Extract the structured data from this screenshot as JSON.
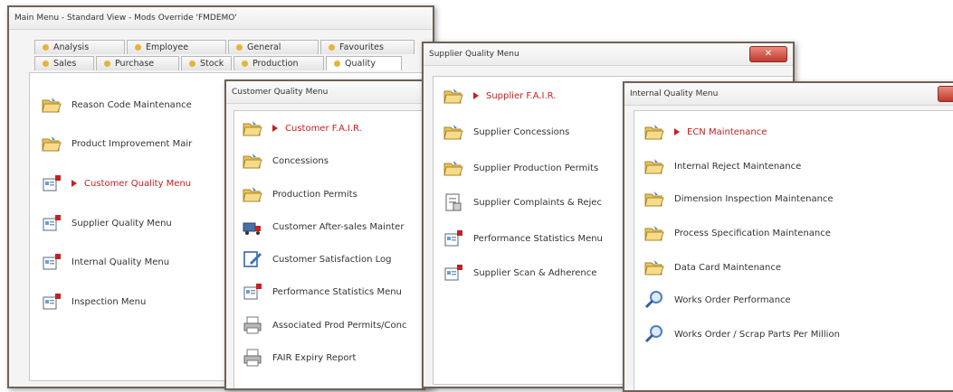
{
  "main_window": {
    "title": "Main Menu - Standard View - Mods Override 'FMDEMO'",
    "tabs_top": [
      "Analysis",
      "Employee",
      "General",
      "Favourites"
    ],
    "tabs_bottom": [
      "Sales",
      "Purchase",
      "Stock",
      "Production",
      "Quality"
    ],
    "items": [
      {
        "label": "Reason Code Maintenance",
        "icon": "folder-icon",
        "active": false
      },
      {
        "label": "Product Improvement Mair",
        "icon": "folder-icon",
        "active": false
      },
      {
        "label": "Customer Quality Menu",
        "icon": "menu-icon",
        "active": true
      },
      {
        "label": "Supplier Quality Menu",
        "icon": "menu-icon",
        "active": false
      },
      {
        "label": "Internal Quality Menu",
        "icon": "menu-icon",
        "active": false
      },
      {
        "label": "Inspection Menu",
        "icon": "menu-icon",
        "active": false
      }
    ]
  },
  "customer_window": {
    "title": "Customer Quality Menu",
    "items": [
      {
        "label": "Customer F.A.I.R.",
        "icon": "folder-icon",
        "active": true
      },
      {
        "label": "Concessions",
        "icon": "folder-icon",
        "active": false
      },
      {
        "label": "Production Permits",
        "icon": "folder-icon",
        "active": false
      },
      {
        "label": "Customer After-sales Mainter",
        "icon": "truck-icon",
        "active": false
      },
      {
        "label": "Customer Satisfaction Log",
        "icon": "edit-icon",
        "active": false
      },
      {
        "label": "Performance Statistics Menu",
        "icon": "menu-icon",
        "active": false
      },
      {
        "label": "Associated Prod Permits/Conc",
        "icon": "printer-icon",
        "active": false
      },
      {
        "label": "FAIR Expiry Report",
        "icon": "printer-icon",
        "active": false
      }
    ]
  },
  "supplier_window": {
    "title": "Supplier Quality Menu",
    "items": [
      {
        "label": "Supplier F.A.I.R.",
        "icon": "folder-icon",
        "active": true
      },
      {
        "label": "Supplier Concessions",
        "icon": "folder-icon",
        "active": false
      },
      {
        "label": "Supplier Production Permits",
        "icon": "folder-icon",
        "active": false
      },
      {
        "label": "Supplier Complaints & Rejec",
        "icon": "document-icon",
        "active": false
      },
      {
        "label": "Performance Statistics Menu",
        "icon": "menu-icon",
        "active": false
      },
      {
        "label": "Supplier Scan & Adherence",
        "icon": "menu-icon",
        "active": false
      }
    ]
  },
  "internal_window": {
    "title": "Internal Quality Menu",
    "items": [
      {
        "label": "ECN Maintenance",
        "icon": "folder-icon",
        "active": true
      },
      {
        "label": "Internal Reject Maintenance",
        "icon": "folder-icon",
        "active": false
      },
      {
        "label": "Dimension Inspection Maintenance",
        "icon": "folder-icon",
        "active": false
      },
      {
        "label": "Process Specification Maintenance",
        "icon": "folder-icon",
        "active": false
      },
      {
        "label": "Data Card Maintenance",
        "icon": "folder-icon",
        "active": false
      },
      {
        "label": "Works Order Performance",
        "icon": "magnifier-icon",
        "active": false
      },
      {
        "label": "Works Order / Scrap Parts Per Million",
        "icon": "magnifier-icon",
        "active": false
      }
    ]
  },
  "colors": {
    "active_text": "#c62020",
    "window_border": "#6f6257",
    "close_button": "#c0392b"
  }
}
